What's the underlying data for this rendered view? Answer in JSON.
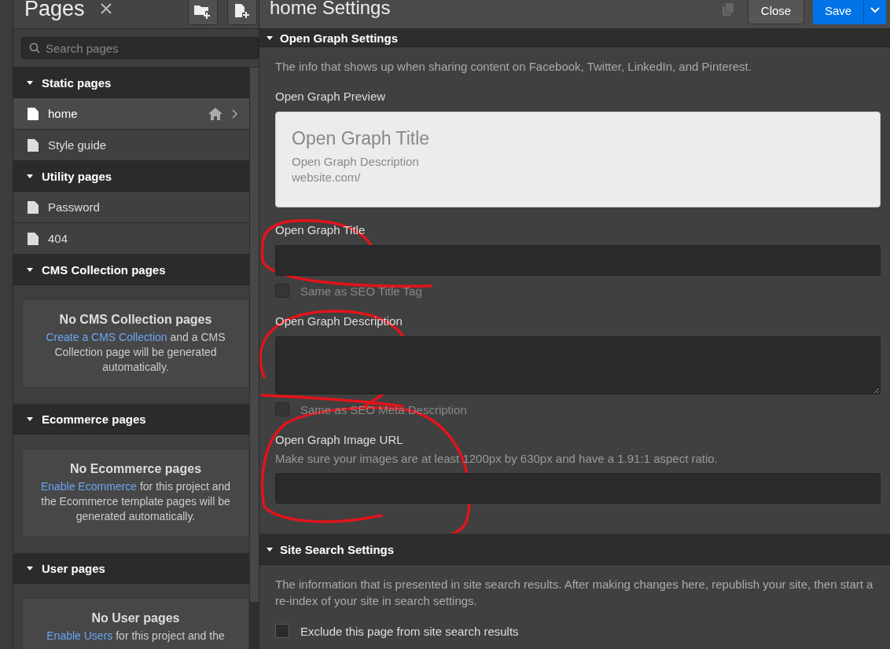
{
  "sidebar": {
    "title": "Pages",
    "search": {
      "placeholder": "Search pages"
    },
    "groups": [
      {
        "label": "Static pages",
        "expanded": true,
        "pages": [
          {
            "name": "home",
            "selected": true,
            "home": true
          },
          {
            "name": "Style guide",
            "selected": false,
            "home": false
          }
        ]
      },
      {
        "label": "Utility pages",
        "expanded": true,
        "pages": [
          {
            "name": "Password",
            "selected": false,
            "home": false
          },
          {
            "name": "404",
            "selected": false,
            "home": false
          }
        ]
      },
      {
        "label": "CMS Collection pages",
        "expanded": true,
        "empty": {
          "title": "No CMS Collection pages",
          "link": "Create a CMS Collection",
          "text": " and a CMS Collection page will be generated automatically."
        }
      },
      {
        "label": "Ecommerce pages",
        "expanded": true,
        "empty": {
          "title": "No Ecommerce pages",
          "link": "Enable Ecommerce",
          "text": " for this project and the Ecommerce template pages will be generated automatically."
        }
      },
      {
        "label": "User pages",
        "expanded": true,
        "empty": {
          "title": "No User pages",
          "link": "Enable Users",
          "text": " for this project and the"
        }
      }
    ]
  },
  "settings": {
    "title": "home Settings",
    "close_button": "Close",
    "save_button": "Save",
    "sections": [
      {
        "title": "Open Graph Settings",
        "expanded": true,
        "description": "The info that shows up when sharing content on Facebook, Twitter, LinkedIn, and Pinterest.",
        "fields": [
          {
            "kind": "preview",
            "label": "Open Graph Preview",
            "title": "Open Graph Title",
            "description": "Open Graph Description",
            "url": "website.com/"
          },
          {
            "kind": "text",
            "label": "Open Graph Title",
            "checkbox": {
              "label": "Same as SEO Title Tag",
              "checked": false,
              "disabled": true
            }
          },
          {
            "kind": "textarea",
            "label": "Open Graph Description",
            "checkbox": {
              "label": "Same as SEO Meta Description",
              "checked": false,
              "disabled": true
            }
          },
          {
            "kind": "text",
            "label": "Open Graph Image URL",
            "hint": "Make sure your images are at least 1200px by 630px and have a 1.91:1 aspect ratio."
          }
        ]
      },
      {
        "title": "Site Search Settings",
        "expanded": true,
        "description": "The information that is presented in site search results. After making changes here, republish your site, then start a re-index of your site in search settings.",
        "fields": [
          {
            "kind": "checkbox",
            "label": "Exclude this page from site search results",
            "checked": false,
            "disabled": false
          }
        ]
      }
    ]
  },
  "annotations": [
    {
      "kind": "one"
    },
    {
      "kind": "two"
    },
    {
      "kind": "three"
    }
  ]
}
